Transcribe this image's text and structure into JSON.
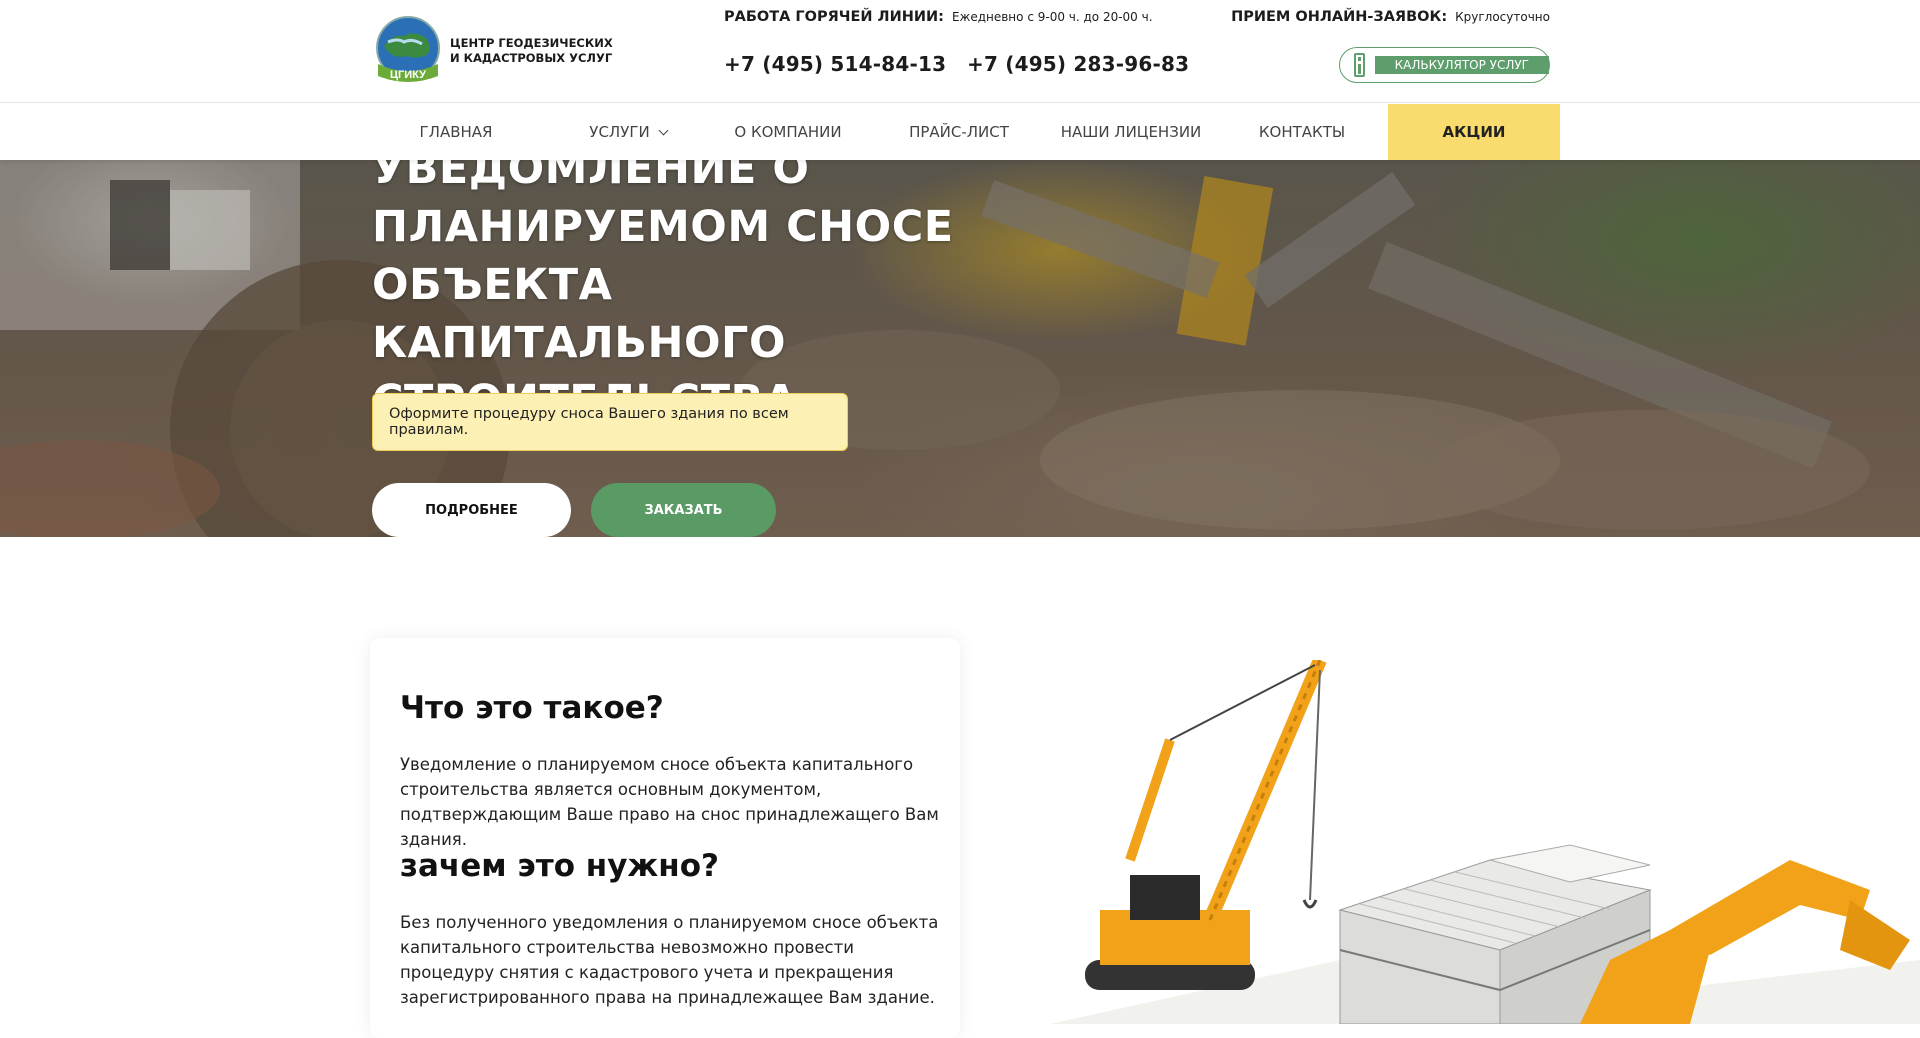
{
  "header": {
    "logo_text_line1": "ЦЕНТР ГЕОДЕЗИЧЕСКИХ",
    "logo_text_line2": "И КАДАСТРОВЫХ УСЛУГ",
    "logo_badge": "ЦГИКУ",
    "hotline_label": "РАБОТА ГОРЯЧЕЙ ЛИНИИ:",
    "hotline_hours": "Ежедневно с 9-00 ч. до 20-00 ч.",
    "phone1": "+7 (495) 514-84-13",
    "phone2": "+7 (495) 283-96-83",
    "online_label": "ПРИЕМ ОНЛАЙН-ЗАЯВОК:",
    "online_hours": "Круглосуточно",
    "calc_label": "КАЛЬКУЛЯТОР УСЛУГ"
  },
  "nav": {
    "items": [
      {
        "label": "ГЛАВНАЯ"
      },
      {
        "label": "УСЛУГИ"
      },
      {
        "label": "О КОМПАНИИ"
      },
      {
        "label": "ПРАЙС-ЛИСТ"
      },
      {
        "label": "НАШИ ЛИЦЕНЗИИ"
      },
      {
        "label": "КОНТАКТЫ"
      },
      {
        "label": "АКЦИИ"
      }
    ]
  },
  "hero": {
    "title_line1": "УВЕДОМЛЕНИЕ О",
    "title_line2": "ПЛАНИРУЕМОМ СНОСЕ",
    "title_line3": "ОБЪЕКТА КАПИТАЛЬНОГО",
    "title_line4": "СТРОИТЕЛЬСТВА",
    "note": "Оформите процедуру сноса Вашего здания по всем правилам.",
    "btn_more": "ПОДРОБНЕЕ",
    "btn_order": "ЗАКАЗАТЬ"
  },
  "content": {
    "heading1": "Что это такое?",
    "para1": "Уведомление о планируемом сносе объекта капитального строительства является основным документом, подтверждающим Ваше право на снос принадлежащего Вам здания.",
    "heading2": "зачем это нужно?",
    "para2": "Без полученного уведомления о планируемом сносе объекта капитального строительства невозможно провести процедуру снятия с кадастрового учета и прекращения зарегистрированного права на принадлежащее Вам здание."
  },
  "colors": {
    "accent_green": "#5a9a65",
    "promo_yellow": "#f9dc6d",
    "note_bg": "#fdf0b4"
  },
  "icons": [
    "logo-globe-icon",
    "calculator-icon",
    "chevron-down-icon"
  ]
}
